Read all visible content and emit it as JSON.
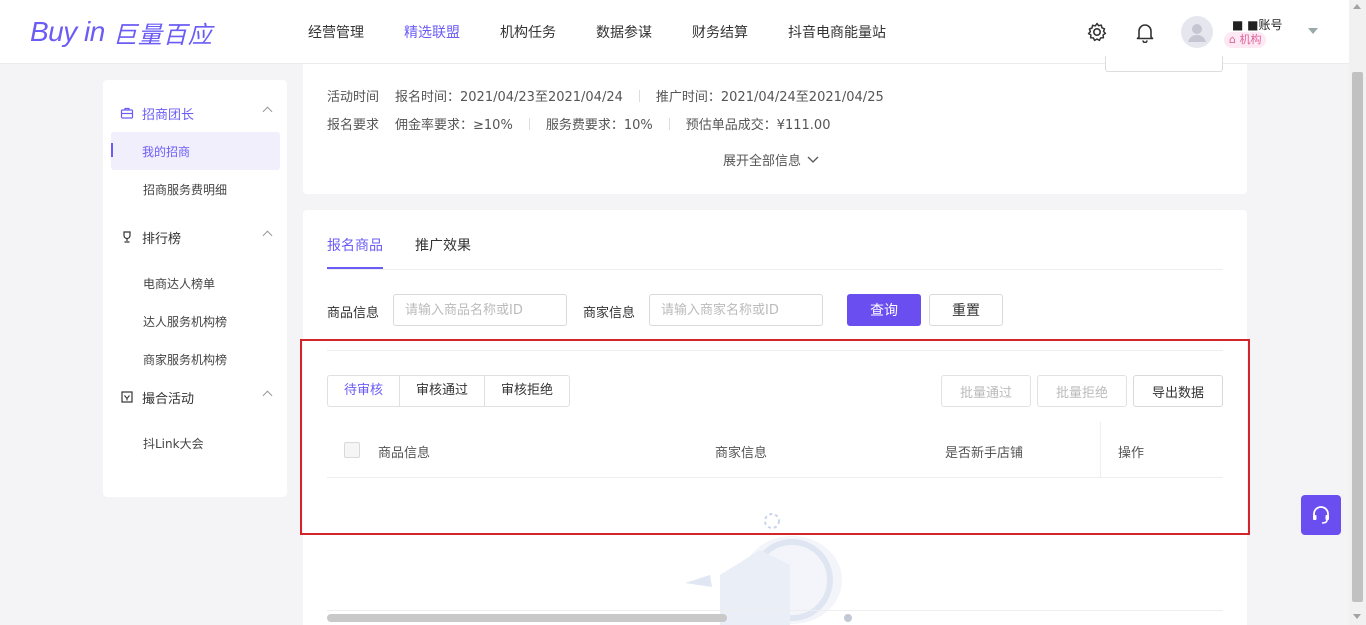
{
  "header": {
    "logo_en": "Buy in",
    "logo_cn": "巨量百应",
    "nav": [
      "经营管理",
      "精选联盟",
      "机构任务",
      "数据参谋",
      "财务结算",
      "抖音电商能量站"
    ],
    "active_nav": "精选联盟",
    "account_name": "■ ■账号",
    "account_badge": "机构"
  },
  "sidebar": {
    "groups": [
      {
        "label": "招商团长",
        "icon": "briefcase-icon",
        "items": [
          "我的招商",
          "招商服务费明细"
        ]
      },
      {
        "label": "排行榜",
        "icon": "trophy-icon",
        "items": [
          "电商达人榜单",
          "达人服务机构榜",
          "商家服务机构榜"
        ]
      },
      {
        "label": "撮合活动",
        "icon": "calendar-icon",
        "items": [
          "抖Link大会"
        ]
      }
    ],
    "active_item": "我的招商"
  },
  "activity": {
    "time_label": "活动时间",
    "signup_time": "报名时间：2021/04/23至2021/04/24",
    "promo_time": "推广时间：2021/04/24至2021/04/25",
    "req_label": "报名要求",
    "commission": "佣金率要求：≥10%",
    "service_fee": "服务费要求：10%",
    "est_deal": "预估单品成交：¥111.00",
    "expand": "展开全部信息"
  },
  "products": {
    "tabs": [
      "报名商品",
      "推广效果"
    ],
    "active_tab": "报名商品",
    "filter": {
      "product_label": "商品信息",
      "product_placeholder": "请输入商品名称或ID",
      "merchant_label": "商家信息",
      "merchant_placeholder": "请输入商家名称或ID",
      "query": "查询",
      "reset": "重置"
    },
    "status_tabs": [
      "待审核",
      "审核通过",
      "审核拒绝"
    ],
    "active_status": "待审核",
    "actions": {
      "batch_approve": "批量通过",
      "batch_reject": "批量拒绝",
      "export": "导出数据"
    },
    "columns": [
      "商品信息",
      "商家信息",
      "是否新手店铺",
      "操作"
    ]
  },
  "colors": {
    "accent": "#6b4ef0",
    "highlight": "#d4242b"
  }
}
